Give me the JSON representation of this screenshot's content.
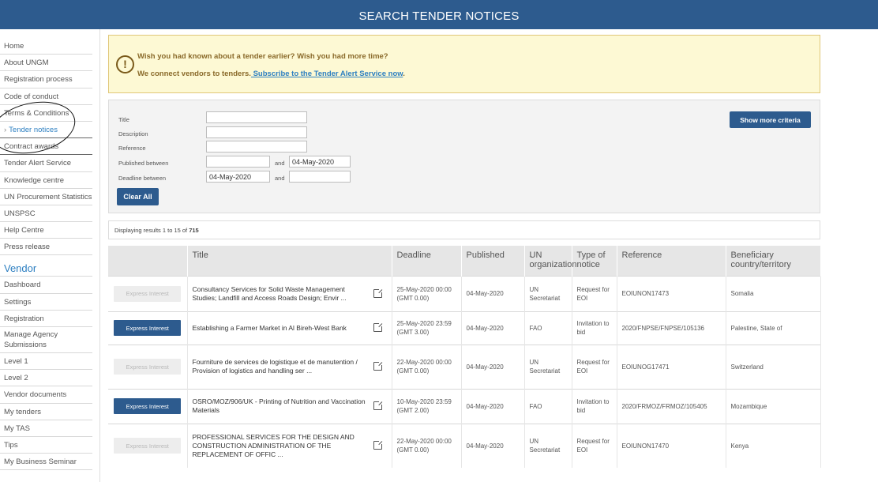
{
  "header": {
    "title": "SEARCH TENDER NOTICES"
  },
  "sidebar": {
    "items": [
      {
        "label": "Home"
      },
      {
        "label": "About UNGM"
      },
      {
        "label": "Registration process"
      },
      {
        "label": "Code of conduct"
      },
      {
        "label": "Terms & Conditions"
      },
      {
        "label": "Tender notices",
        "active": true
      },
      {
        "label": "Contract awards"
      },
      {
        "label": "Tender Alert Service"
      },
      {
        "label": "Knowledge centre"
      },
      {
        "label": "UN Procurement Statistics"
      },
      {
        "label": "UNSPSC"
      },
      {
        "label": "Help Centre"
      },
      {
        "label": "Press release"
      }
    ],
    "vendor_heading": "Vendor",
    "vendor_items": [
      {
        "label": "Dashboard"
      },
      {
        "label": "Settings"
      },
      {
        "label": "Registration"
      },
      {
        "label": "Manage Agency Submissions"
      },
      {
        "label": "Level 1"
      },
      {
        "label": "Level 2"
      },
      {
        "label": "Vendor documents"
      },
      {
        "label": "My tenders"
      },
      {
        "label": "My TAS"
      },
      {
        "label": "Tips"
      },
      {
        "label": "My Business Seminar"
      }
    ]
  },
  "alert": {
    "icon": "exclamation-circle-icon",
    "line1": "Wish you had known about a tender earlier? Wish you had more time?",
    "line2_prefix": "We connect vendors to tenders.",
    "link": " Subscribe to the Tender Alert Service now",
    "line2_suffix": "."
  },
  "criteria": {
    "title_label": "Title",
    "description_label": "Description",
    "reference_label": "Reference",
    "published_label": "Published between",
    "deadline_label": "Deadline between",
    "and_label": "and",
    "title_value": "",
    "description_value": "",
    "reference_value": "",
    "published_from": "",
    "published_to": "04-May-2020",
    "deadline_from": "04-May-2020",
    "deadline_to": "",
    "clear_all": "Clear All",
    "show_more": "Show more criteria"
  },
  "results": {
    "prefix": "Displaying results 1 to 15 of ",
    "total": "715"
  },
  "table": {
    "headers": [
      "",
      "Title",
      "Deadline",
      "Published",
      "UN organization",
      "Type of notice",
      "Reference",
      "Beneficiary country/territory"
    ],
    "express_label": "Express Interest",
    "rows": [
      {
        "enabled": false,
        "title": "Consultancy Services for Solid Waste Management Studies; Landfill and Access Roads Design; Envir ...",
        "deadline": "25-May-2020 00:00 (GMT 0.00)",
        "published": "04-May-2020",
        "org": "UN Secretariat",
        "type": "Request for EOI",
        "reference": "EOIUNON17473",
        "country": "Somalia"
      },
      {
        "enabled": true,
        "title": "Establishing a Farmer Market in Al Bireh-West Bank",
        "deadline": "25-May-2020 23:59 (GMT 3.00)",
        "published": "04-May-2020",
        "org": "FAO",
        "type": "Invitation to bid",
        "reference": "2020/FNPSE/FNPSE/105136",
        "country": "Palestine, State of"
      },
      {
        "enabled": false,
        "title": "Fourniture de services de logistique et de manutention / Provision of logistics and handling ser ...",
        "deadline": "22-May-2020 00:00 (GMT 0.00)",
        "published": "04-May-2020",
        "org": "UN Secretariat",
        "type": "Request for EOI",
        "reference": "EOIUNOG17471",
        "country": "Switzerland"
      },
      {
        "enabled": true,
        "title": "OSRO/MOZ/906/UK - Printing of Nutrition and Vaccination Materials",
        "deadline": "10-May-2020 23:59 (GMT 2.00)",
        "published": "04-May-2020",
        "org": "FAO",
        "type": "Invitation to bid",
        "reference": "2020/FRMOZ/FRMOZ/105405",
        "country": "Mozambique"
      },
      {
        "enabled": false,
        "title": "PROFESSIONAL SERVICES FOR THE DESIGN AND CONSTRUCTION ADMINISTRATION OF THE REPLACEMENT OF OFFIC ...",
        "deadline": "22-May-2020 00:00 (GMT 0.00)",
        "published": "04-May-2020",
        "org": "UN Secretariat",
        "type": "Request for EOI",
        "reference": "EOIUNON17470",
        "country": "Kenya"
      }
    ]
  },
  "icons": {
    "external_link": "external-link-icon",
    "sidebar_chevron": "chevron-right-icon"
  }
}
